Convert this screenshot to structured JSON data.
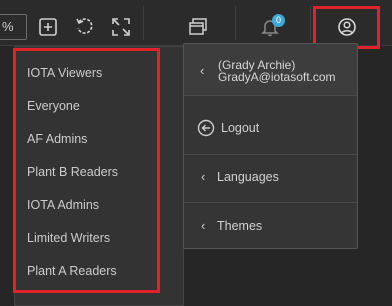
{
  "toolbar": {
    "zoom_value": "%",
    "notification_count": "0",
    "icons": [
      "add-icon",
      "refresh-icon",
      "fullscreen-icon",
      "windows-icon",
      "bell-icon",
      "user-circle-icon"
    ]
  },
  "groups_list": {
    "items": [
      "IOTA Viewers",
      "Everyone",
      "AF Admins",
      "Plant B Readers",
      "IOTA Admins",
      "Limited Writers",
      "Plant A Readers"
    ]
  },
  "account_menu": {
    "user_name": "(Grady Archie)",
    "user_email": "GradyA@iotasoft.com",
    "logout_label": "Logout",
    "languages_label": "Languages",
    "themes_label": "Themes"
  },
  "colors": {
    "background": "#262626",
    "panel": "#333333",
    "highlight": "#e0232b",
    "badge": "#3ea8d8"
  }
}
